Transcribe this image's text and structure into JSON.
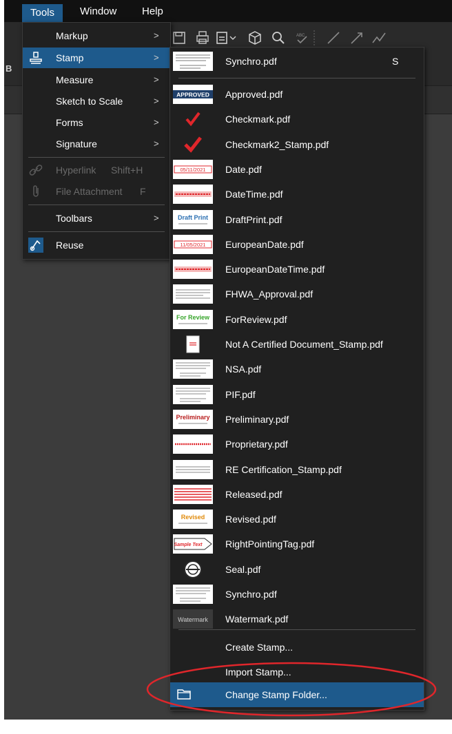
{
  "menubar": {
    "items": [
      {
        "label": "Tools"
      },
      {
        "label": "Window"
      },
      {
        "label": "Help"
      }
    ]
  },
  "toolbar": {
    "left_letter": "B",
    "icons": [
      "save-icon",
      "print-icon",
      "stamp-dropdown-icon",
      "cube-icon",
      "zoom-icon",
      "spellcheck-icon",
      "line-icon",
      "arrow-icon",
      "polyline-icon"
    ]
  },
  "tools_menu": {
    "items": [
      {
        "label": "Markup",
        "shortcut": "",
        "has_submenu": true,
        "state": "normal"
      },
      {
        "label": "Stamp",
        "shortcut": "",
        "has_submenu": true,
        "state": "highlighted"
      },
      {
        "label": "Measure",
        "shortcut": "",
        "has_submenu": true,
        "state": "normal"
      },
      {
        "label": "Sketch to Scale",
        "shortcut": "",
        "has_submenu": true,
        "state": "normal"
      },
      {
        "label": "Forms",
        "shortcut": "",
        "has_submenu": true,
        "state": "normal"
      },
      {
        "label": "Signature",
        "shortcut": "",
        "has_submenu": true,
        "state": "normal"
      },
      {
        "label": "Hyperlink",
        "shortcut": "Shift+H",
        "has_submenu": false,
        "state": "disabled"
      },
      {
        "label": "File Attachment",
        "shortcut": "F",
        "has_submenu": false,
        "state": "disabled"
      },
      {
        "label": "Toolbars",
        "shortcut": "",
        "has_submenu": true,
        "state": "normal"
      },
      {
        "label": "Reuse",
        "shortcut": "",
        "has_submenu": false,
        "state": "normal"
      }
    ],
    "arrow_glyph": ">"
  },
  "stamp_menu": {
    "recent": {
      "label": "Synchro.pdf",
      "shortcut": "S"
    },
    "stamps": [
      {
        "label": "Approved.pdf",
        "thumb_text": "APPROVED"
      },
      {
        "label": "Checkmark.pdf",
        "thumb_text": ""
      },
      {
        "label": "Checkmark2_Stamp.pdf",
        "thumb_text": ""
      },
      {
        "label": "Date.pdf",
        "thumb_text": "05/11/2021"
      },
      {
        "label": "DateTime.pdf",
        "thumb_text": ""
      },
      {
        "label": "DraftPrint.pdf",
        "thumb_text": "Draft Print"
      },
      {
        "label": "EuropeanDate.pdf",
        "thumb_text": "11/05/2021"
      },
      {
        "label": "EuropeanDateTime.pdf",
        "thumb_text": ""
      },
      {
        "label": "FHWA_Approval.pdf",
        "thumb_text": ""
      },
      {
        "label": "ForReview.pdf",
        "thumb_text": "For Review"
      },
      {
        "label": "Not A Certified Document_Stamp.pdf",
        "thumb_text": ""
      },
      {
        "label": "NSA.pdf",
        "thumb_text": ""
      },
      {
        "label": "PIF.pdf",
        "thumb_text": ""
      },
      {
        "label": "Preliminary.pdf",
        "thumb_text": "Preliminary"
      },
      {
        "label": "Proprietary.pdf",
        "thumb_text": ""
      },
      {
        "label": "RE Certification_Stamp.pdf",
        "thumb_text": ""
      },
      {
        "label": "Released.pdf",
        "thumb_text": ""
      },
      {
        "label": "Revised.pdf",
        "thumb_text": "Revised"
      },
      {
        "label": "RightPointingTag.pdf",
        "thumb_text": "Sample Text"
      },
      {
        "label": "Seal.pdf",
        "thumb_text": ""
      },
      {
        "label": "Synchro.pdf",
        "thumb_text": ""
      },
      {
        "label": "Watermark.pdf",
        "thumb_text": "Watermark"
      }
    ],
    "actions": [
      {
        "label": "Create Stamp...",
        "state": "normal"
      },
      {
        "label": "Import Stamp...",
        "state": "normal"
      },
      {
        "label": "Change Stamp Folder...",
        "state": "highlighted"
      }
    ]
  },
  "colors": {
    "menu_bg": "#202020",
    "highlight": "#1e5a8c",
    "annotation_red": "#e0262b",
    "disabled_text": "#6a6a6a"
  }
}
